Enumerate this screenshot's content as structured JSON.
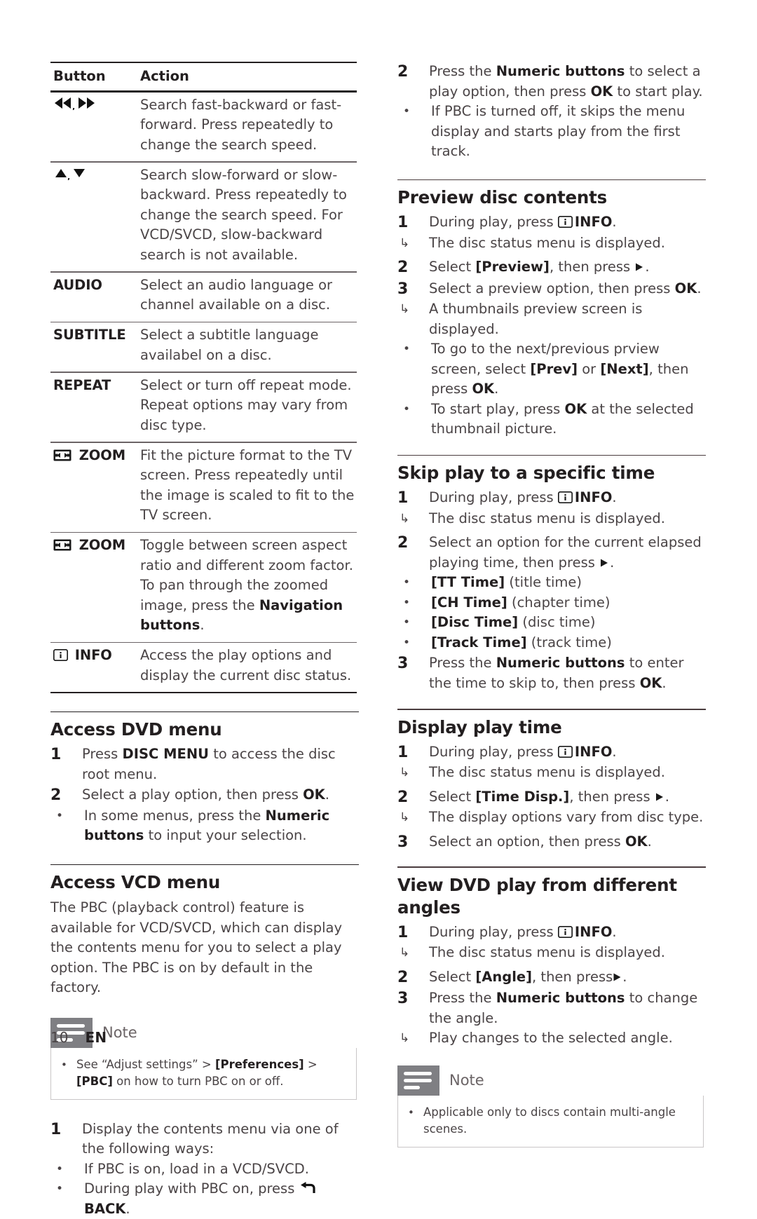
{
  "table": {
    "headers": [
      "Button",
      "Action"
    ],
    "rows": [
      {
        "button_icon": "rewind-fastforward-icon",
        "button": "",
        "action": "Search fast-backward or fast-forward. Press repeatedly to change the search speed."
      },
      {
        "button_icon": "up-down-triangle-icon",
        "button": "",
        "action": "Search slow-forward or slow-backward. Press repeatedly to change the search speed.",
        "action2": "For VCD/SVCD, slow-backward search is not available."
      },
      {
        "button_icon": "",
        "button": "AUDIO",
        "action": "Select an audio language or channel available on a disc."
      },
      {
        "button_icon": "",
        "button": "SUBTITLE",
        "action": "Select a subtitle language availabel on a disc."
      },
      {
        "button_icon": "",
        "button": "REPEAT",
        "action": "Select or turn off repeat mode. Repeat options may vary from disc type."
      },
      {
        "button_icon": "zoom-icon",
        "button": "ZOOM",
        "action": "Fit the picture format to the TV screen.",
        "action2": "Press repeatedly until the image is scaled to fit to the TV screen."
      },
      {
        "button_icon": "zoom-icon",
        "button": "ZOOM",
        "action": "Toggle between screen aspect ratio and different zoom factor.",
        "action2_pre": "To pan through the zoomed image, press the ",
        "action2_bold": "Navigation buttons",
        "action2_post": "."
      },
      {
        "button_icon": "info-icon",
        "button": "INFO",
        "action": "Access the play options and display the current disc status."
      }
    ]
  },
  "access_dvd_menu": {
    "heading": "Access DVD menu",
    "step1_num": "1",
    "step1_pre": "Press ",
    "step1_bold": "DISC MENU",
    "step1_post": " to access the disc root menu.",
    "step2_num": "2",
    "step2_pre": "Select a play option, then press ",
    "step2_bold": "OK",
    "step2_post": ".",
    "bullet_dot": "•",
    "bullet_pre": "In some menus, press the ",
    "bullet_bold": "Numeric buttons",
    "bullet_post": " to input your selection."
  },
  "access_vcd_menu": {
    "heading": "Access VCD menu",
    "paragraph": "The PBC (playback control) feature is available for VCD/SVCD, which can display the contents menu for you to select a play option. The PBC is on by default in the factory.",
    "note": {
      "title": "Note",
      "dot": "•",
      "pre": "See “Adjust settings” > ",
      "bold1": "[Preferences]",
      "mid": " > ",
      "bold2": "[PBC]",
      "post": " on how to turn PBC on or off."
    },
    "step1_num": "1",
    "step1_text": "Display the contents menu via one of the following ways:",
    "bullet_dot": "•",
    "bullet1": "If PBC is on, load in a VCD/SVCD.",
    "bullet2_pre": "During play with PBC on, press ",
    "bullet2_icon": "back-arrow-icon",
    "bullet2_bold": "BACK",
    "bullet2_post": "."
  },
  "vcd_continued": {
    "step2_num": "2",
    "step2_pre": "Press the ",
    "step2_bold1": "Numeric buttons",
    "step2_mid": " to select a play option, then press ",
    "step2_bold2": "OK",
    "step2_post": " to start play.",
    "bullet_dot": "•",
    "bullet_text": "If PBC is turned off, it skips the menu display and starts play from the first track."
  },
  "preview_disc_contents": {
    "heading": "Preview disc contents",
    "step1_num": "1",
    "step1_pre": "During play, press ",
    "step1_icon": "info-icon",
    "step1_bold": "INFO",
    "step1_post": ".",
    "arrow": "↳",
    "result1": "The disc status menu is displayed.",
    "step2_num": "2",
    "step2_pre": "Select ",
    "step2_bold": "[Preview]",
    "step2_mid": ", then press ",
    "step2_icon": "play-triangle-icon",
    "step2_post": ".",
    "step3_num": "3",
    "step3_pre": "Select a preview option, then press ",
    "step3_bold": "OK",
    "step3_post": ".",
    "result3": "A thumbnails preview screen is displayed.",
    "bullet_dot": "•",
    "bullet1_pre": "To go to the next/previous prview screen, select ",
    "bullet1_bold1": "[Prev]",
    "bullet1_mid": " or ",
    "bullet1_bold2": "[Next]",
    "bullet1_mid2": ", then press ",
    "bullet1_bold3": "OK",
    "bullet1_post": ".",
    "bullet2_pre": "To start play, press ",
    "bullet2_bold": "OK",
    "bullet2_post": " at the selected thumbnail picture."
  },
  "skip_play": {
    "heading": "Skip play to a specific time",
    "step1_num": "1",
    "step1_pre": "During play, press ",
    "step1_icon": "info-icon",
    "step1_bold": "INFO",
    "step1_post": ".",
    "arrow": "↳",
    "result1": "The disc status menu is displayed.",
    "step2_num": "2",
    "step2_pre": "Select an option for the current elapsed playing time, then press ",
    "step2_icon": "play-triangle-icon",
    "step2_post": ".",
    "bullet_dot": "•",
    "options": [
      {
        "bold": "[TT Time]",
        "plain": " (title time)"
      },
      {
        "bold": "[CH Time]",
        "plain": " (chapter time)"
      },
      {
        "bold": "[Disc Time]",
        "plain": " (disc time)"
      },
      {
        "bold": "[Track Time]",
        "plain": " (track time)"
      }
    ],
    "step3_num": "3",
    "step3_pre": "Press the ",
    "step3_bold1": "Numeric buttons",
    "step3_mid": " to enter the time to skip to, then press ",
    "step3_bold2": "OK",
    "step3_post": "."
  },
  "display_play_time": {
    "heading": "Display play time",
    "step1_num": "1",
    "step1_pre": "During play, press ",
    "step1_icon": "info-icon",
    "step1_bold": "INFO",
    "step1_post": ".",
    "arrow": "↳",
    "result1": "The disc status menu is displayed.",
    "step2_num": "2",
    "step2_pre": "Select ",
    "step2_bold": "[Time Disp.]",
    "step2_mid": ", then press ",
    "step2_icon": "play-triangle-icon",
    "step2_post": ".",
    "result2": "The display options vary from disc type.",
    "step3_num": "3",
    "step3_pre": "Select an option, then press ",
    "step3_bold": "OK",
    "step3_post": "."
  },
  "view_angles": {
    "heading": "View DVD play from different angles",
    "step1_num": "1",
    "step1_pre": "During play, press ",
    "step1_icon": "info-icon",
    "step1_bold": "INFO",
    "step1_post": ".",
    "arrow": "↳",
    "result1": "The disc status menu is displayed.",
    "step2_num": "2",
    "step2_pre": "Select ",
    "step2_bold": "[Angle]",
    "step2_mid": ", then press",
    "step2_icon": "play-triangle-icon",
    "step2_post": ".",
    "step3_num": "3",
    "step3_pre": "Press the ",
    "step3_bold": "Numeric buttons",
    "step3_post": " to change the angle.",
    "result3": "Play changes to the selected angle.",
    "note": {
      "title": "Note",
      "dot": "•",
      "text": "Applicable only to discs contain multi-angle scenes."
    }
  },
  "footer": {
    "page_number": "10",
    "language": "EN"
  }
}
